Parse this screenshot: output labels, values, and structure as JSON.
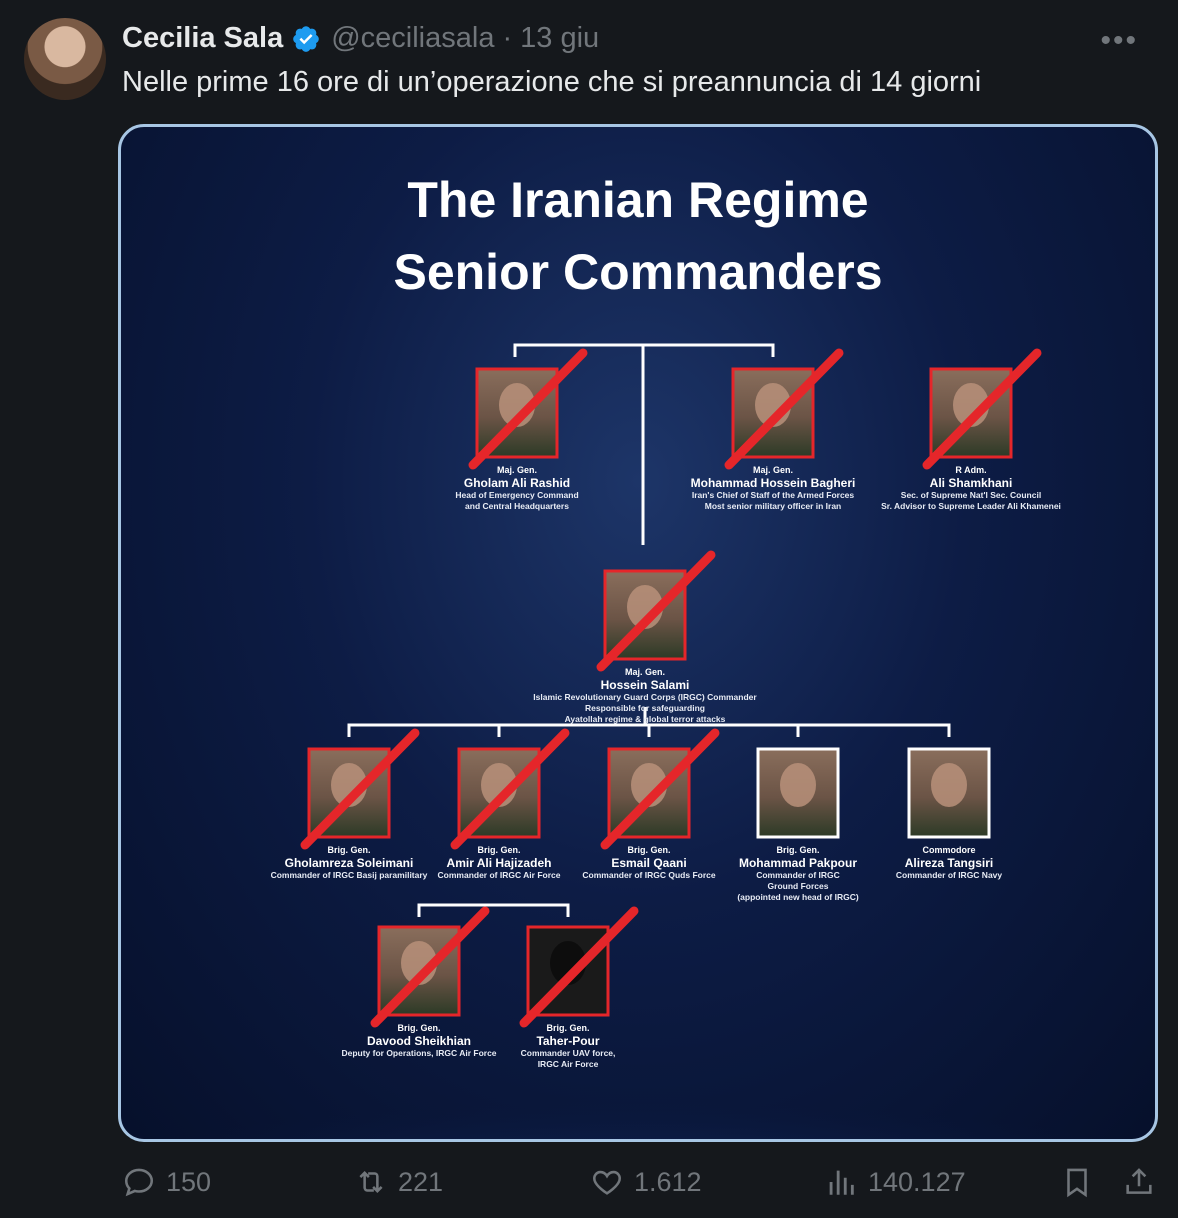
{
  "tweet": {
    "author_name": "Cecilia Sala",
    "handle": "@ceciliasala",
    "separator": "·",
    "date": "13 giu",
    "more_label": "•••",
    "text": "Nelle prime 16 ore di un’operazione che si preannuncia di 14 giorni"
  },
  "image": {
    "title_line1": "The Iranian Regime",
    "title_line2": "Senior Commanders",
    "commanders": [
      {
        "rank": "Maj. Gen.",
        "name": "Gholam Ali Rashid",
        "desc": [
          "Head of Emergency Command",
          "and Central Headquarters"
        ],
        "crossed": true
      },
      {
        "rank": "Maj. Gen.",
        "name": "Mohammad Hossein Bagheri",
        "desc": [
          "Iran's Chief of Staff of the Armed Forces",
          "Most senior military officer in Iran"
        ],
        "crossed": true
      },
      {
        "rank": "R Adm.",
        "name": "Ali Shamkhani",
        "desc": [
          "Sec. of Supreme Nat'l Sec. Council",
          "Sr. Advisor to Supreme Leader Ali Khamenei"
        ],
        "crossed": true
      },
      {
        "rank": "Maj. Gen.",
        "name": "Hossein Salami",
        "desc": [
          "Islamic Revolutionary Guard Corps (IRGC) Commander",
          "Responsible for safeguarding",
          "Ayatollah regime & global terror attacks"
        ],
        "crossed": true
      },
      {
        "rank": "Brig. Gen.",
        "name": "Gholamreza Soleimani",
        "desc": [
          "Commander of IRGC Basij paramilitary"
        ],
        "crossed": true
      },
      {
        "rank": "Brig. Gen.",
        "name": "Amir Ali Hajizadeh",
        "desc": [
          "Commander of IRGC Air Force"
        ],
        "crossed": true
      },
      {
        "rank": "Brig. Gen.",
        "name": "Esmail Qaani",
        "desc": [
          "Commander of IRGC Quds Force"
        ],
        "crossed": true
      },
      {
        "rank": "Brig. Gen.",
        "name": "Mohammad Pakpour",
        "desc": [
          "Commander of IRGC",
          "Ground Forces",
          "(appointed new head of IRGC)"
        ],
        "crossed": false
      },
      {
        "rank": "Commodore",
        "name": "Alireza Tangsiri",
        "desc": [
          "Commander of IRGC Navy"
        ],
        "crossed": false
      },
      {
        "rank": "Brig. Gen.",
        "name": "Davood Sheikhian",
        "desc": [
          "Deputy for Operations, IRGC Air Force"
        ],
        "crossed": true
      },
      {
        "rank": "Brig. Gen.",
        "name": "Taher-Pour",
        "desc": [
          "Commander UAV force,",
          "IRGC Air Force"
        ],
        "crossed": true
      }
    ]
  },
  "actions": {
    "replies": "150",
    "reposts": "221",
    "likes": "1.612",
    "views": "140.127"
  },
  "colors": {
    "background": "#15181c",
    "text": "#e7e9ea",
    "muted": "#71767b",
    "verified": "#1d9bf0",
    "cross": "#e5262a",
    "media_border": "#a7c6e4"
  },
  "icons": [
    "verified-icon",
    "more-icon",
    "reply-icon",
    "repost-icon",
    "like-icon",
    "views-icon",
    "bookmark-icon",
    "share-icon"
  ]
}
